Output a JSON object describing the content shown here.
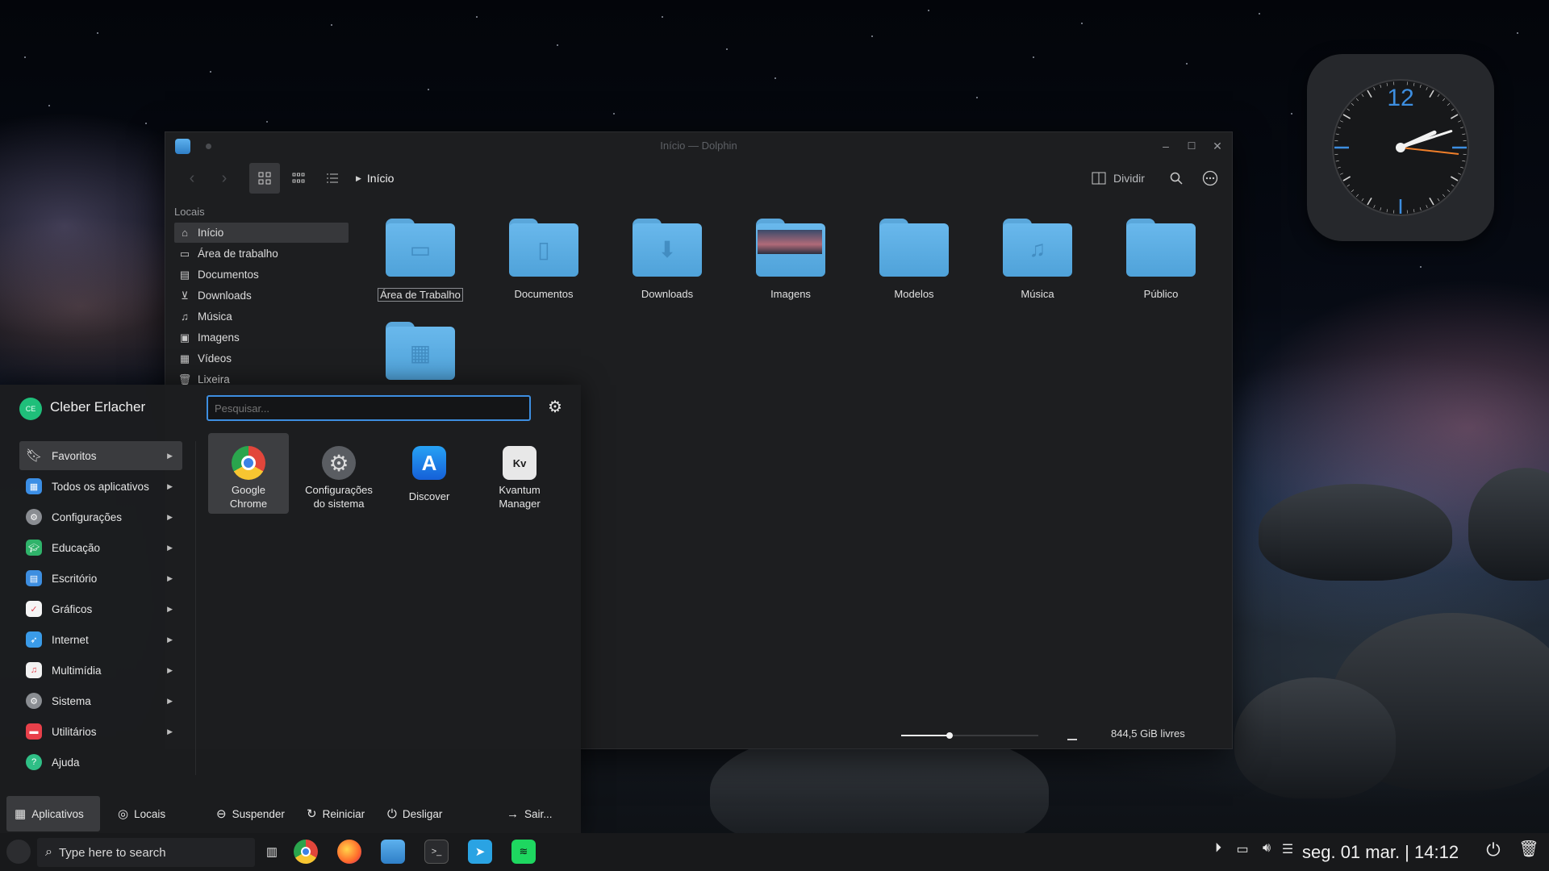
{
  "dolphin": {
    "title": "Início — Dolphin",
    "breadcrumb": "Início",
    "split_label": "Dividir",
    "places_header": "Locais",
    "places": [
      "Início",
      "Área de trabalho",
      "Documentos",
      "Downloads",
      "Música",
      "Imagens",
      "Vídeos",
      "Lixeira"
    ],
    "folders": [
      "Área de Trabalho",
      "Documentos",
      "Downloads",
      "Imagens",
      "Modelos",
      "Música",
      "Público"
    ],
    "free_space": "844,5 GiB livres",
    "zoom_level": 0.35
  },
  "launcher": {
    "user_initials": "CE",
    "user_name": "Cleber Erlacher",
    "search_placeholder": "Pesquisar...",
    "categories": [
      "Favoritos",
      "Todos os aplicativos",
      "Configurações",
      "Educação",
      "Escritório",
      "Gráficos",
      "Internet",
      "Multimídia",
      "Sistema",
      "Utilitários",
      "Ajuda"
    ],
    "favorites": [
      {
        "line1": "Google",
        "line2": "Chrome"
      },
      {
        "line1": "Configurações",
        "line2": "do sistema"
      },
      {
        "line1": "Discover",
        "line2": ""
      },
      {
        "line1": "Kvantum",
        "line2": "Manager"
      }
    ],
    "tabs": {
      "apps": "Aplicativos",
      "places": "Locais"
    },
    "actions": {
      "suspend": "Suspender",
      "restart": "Reiniciar",
      "shutdown": "Desligar",
      "logout": "Sair..."
    }
  },
  "clock": {
    "twelve": "12",
    "time_hours": 2,
    "time_minutes": 12
  },
  "taskbar": {
    "search_placeholder": "Type here to search",
    "datetime": "seg. 01 mar. | 14:12"
  },
  "colors": {
    "accent": "#3d8ee0",
    "folder": "#5aa7db",
    "clock_second": "#f07f2a"
  }
}
